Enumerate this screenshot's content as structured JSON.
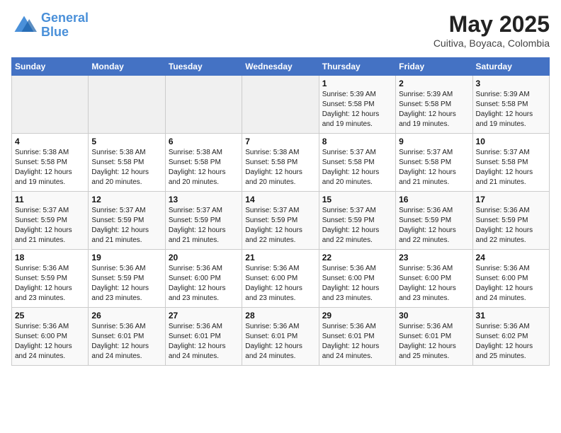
{
  "logo": {
    "line1": "General",
    "line2": "Blue"
  },
  "title": "May 2025",
  "subtitle": "Cuitiva, Boyaca, Colombia",
  "weekdays": [
    "Sunday",
    "Monday",
    "Tuesday",
    "Wednesday",
    "Thursday",
    "Friday",
    "Saturday"
  ],
  "weeks": [
    [
      {
        "day": "",
        "info": ""
      },
      {
        "day": "",
        "info": ""
      },
      {
        "day": "",
        "info": ""
      },
      {
        "day": "",
        "info": ""
      },
      {
        "day": "1",
        "info": "Sunrise: 5:39 AM\nSunset: 5:58 PM\nDaylight: 12 hours\nand 19 minutes."
      },
      {
        "day": "2",
        "info": "Sunrise: 5:39 AM\nSunset: 5:58 PM\nDaylight: 12 hours\nand 19 minutes."
      },
      {
        "day": "3",
        "info": "Sunrise: 5:39 AM\nSunset: 5:58 PM\nDaylight: 12 hours\nand 19 minutes."
      }
    ],
    [
      {
        "day": "4",
        "info": "Sunrise: 5:38 AM\nSunset: 5:58 PM\nDaylight: 12 hours\nand 19 minutes."
      },
      {
        "day": "5",
        "info": "Sunrise: 5:38 AM\nSunset: 5:58 PM\nDaylight: 12 hours\nand 20 minutes."
      },
      {
        "day": "6",
        "info": "Sunrise: 5:38 AM\nSunset: 5:58 PM\nDaylight: 12 hours\nand 20 minutes."
      },
      {
        "day": "7",
        "info": "Sunrise: 5:38 AM\nSunset: 5:58 PM\nDaylight: 12 hours\nand 20 minutes."
      },
      {
        "day": "8",
        "info": "Sunrise: 5:37 AM\nSunset: 5:58 PM\nDaylight: 12 hours\nand 20 minutes."
      },
      {
        "day": "9",
        "info": "Sunrise: 5:37 AM\nSunset: 5:58 PM\nDaylight: 12 hours\nand 21 minutes."
      },
      {
        "day": "10",
        "info": "Sunrise: 5:37 AM\nSunset: 5:58 PM\nDaylight: 12 hours\nand 21 minutes."
      }
    ],
    [
      {
        "day": "11",
        "info": "Sunrise: 5:37 AM\nSunset: 5:59 PM\nDaylight: 12 hours\nand 21 minutes."
      },
      {
        "day": "12",
        "info": "Sunrise: 5:37 AM\nSunset: 5:59 PM\nDaylight: 12 hours\nand 21 minutes."
      },
      {
        "day": "13",
        "info": "Sunrise: 5:37 AM\nSunset: 5:59 PM\nDaylight: 12 hours\nand 21 minutes."
      },
      {
        "day": "14",
        "info": "Sunrise: 5:37 AM\nSunset: 5:59 PM\nDaylight: 12 hours\nand 22 minutes."
      },
      {
        "day": "15",
        "info": "Sunrise: 5:37 AM\nSunset: 5:59 PM\nDaylight: 12 hours\nand 22 minutes."
      },
      {
        "day": "16",
        "info": "Sunrise: 5:36 AM\nSunset: 5:59 PM\nDaylight: 12 hours\nand 22 minutes."
      },
      {
        "day": "17",
        "info": "Sunrise: 5:36 AM\nSunset: 5:59 PM\nDaylight: 12 hours\nand 22 minutes."
      }
    ],
    [
      {
        "day": "18",
        "info": "Sunrise: 5:36 AM\nSunset: 5:59 PM\nDaylight: 12 hours\nand 23 minutes."
      },
      {
        "day": "19",
        "info": "Sunrise: 5:36 AM\nSunset: 5:59 PM\nDaylight: 12 hours\nand 23 minutes."
      },
      {
        "day": "20",
        "info": "Sunrise: 5:36 AM\nSunset: 6:00 PM\nDaylight: 12 hours\nand 23 minutes."
      },
      {
        "day": "21",
        "info": "Sunrise: 5:36 AM\nSunset: 6:00 PM\nDaylight: 12 hours\nand 23 minutes."
      },
      {
        "day": "22",
        "info": "Sunrise: 5:36 AM\nSunset: 6:00 PM\nDaylight: 12 hours\nand 23 minutes."
      },
      {
        "day": "23",
        "info": "Sunrise: 5:36 AM\nSunset: 6:00 PM\nDaylight: 12 hours\nand 23 minutes."
      },
      {
        "day": "24",
        "info": "Sunrise: 5:36 AM\nSunset: 6:00 PM\nDaylight: 12 hours\nand 24 minutes."
      }
    ],
    [
      {
        "day": "25",
        "info": "Sunrise: 5:36 AM\nSunset: 6:00 PM\nDaylight: 12 hours\nand 24 minutes."
      },
      {
        "day": "26",
        "info": "Sunrise: 5:36 AM\nSunset: 6:01 PM\nDaylight: 12 hours\nand 24 minutes."
      },
      {
        "day": "27",
        "info": "Sunrise: 5:36 AM\nSunset: 6:01 PM\nDaylight: 12 hours\nand 24 minutes."
      },
      {
        "day": "28",
        "info": "Sunrise: 5:36 AM\nSunset: 6:01 PM\nDaylight: 12 hours\nand 24 minutes."
      },
      {
        "day": "29",
        "info": "Sunrise: 5:36 AM\nSunset: 6:01 PM\nDaylight: 12 hours\nand 24 minutes."
      },
      {
        "day": "30",
        "info": "Sunrise: 5:36 AM\nSunset: 6:01 PM\nDaylight: 12 hours\nand 25 minutes."
      },
      {
        "day": "31",
        "info": "Sunrise: 5:36 AM\nSunset: 6:02 PM\nDaylight: 12 hours\nand 25 minutes."
      }
    ]
  ]
}
